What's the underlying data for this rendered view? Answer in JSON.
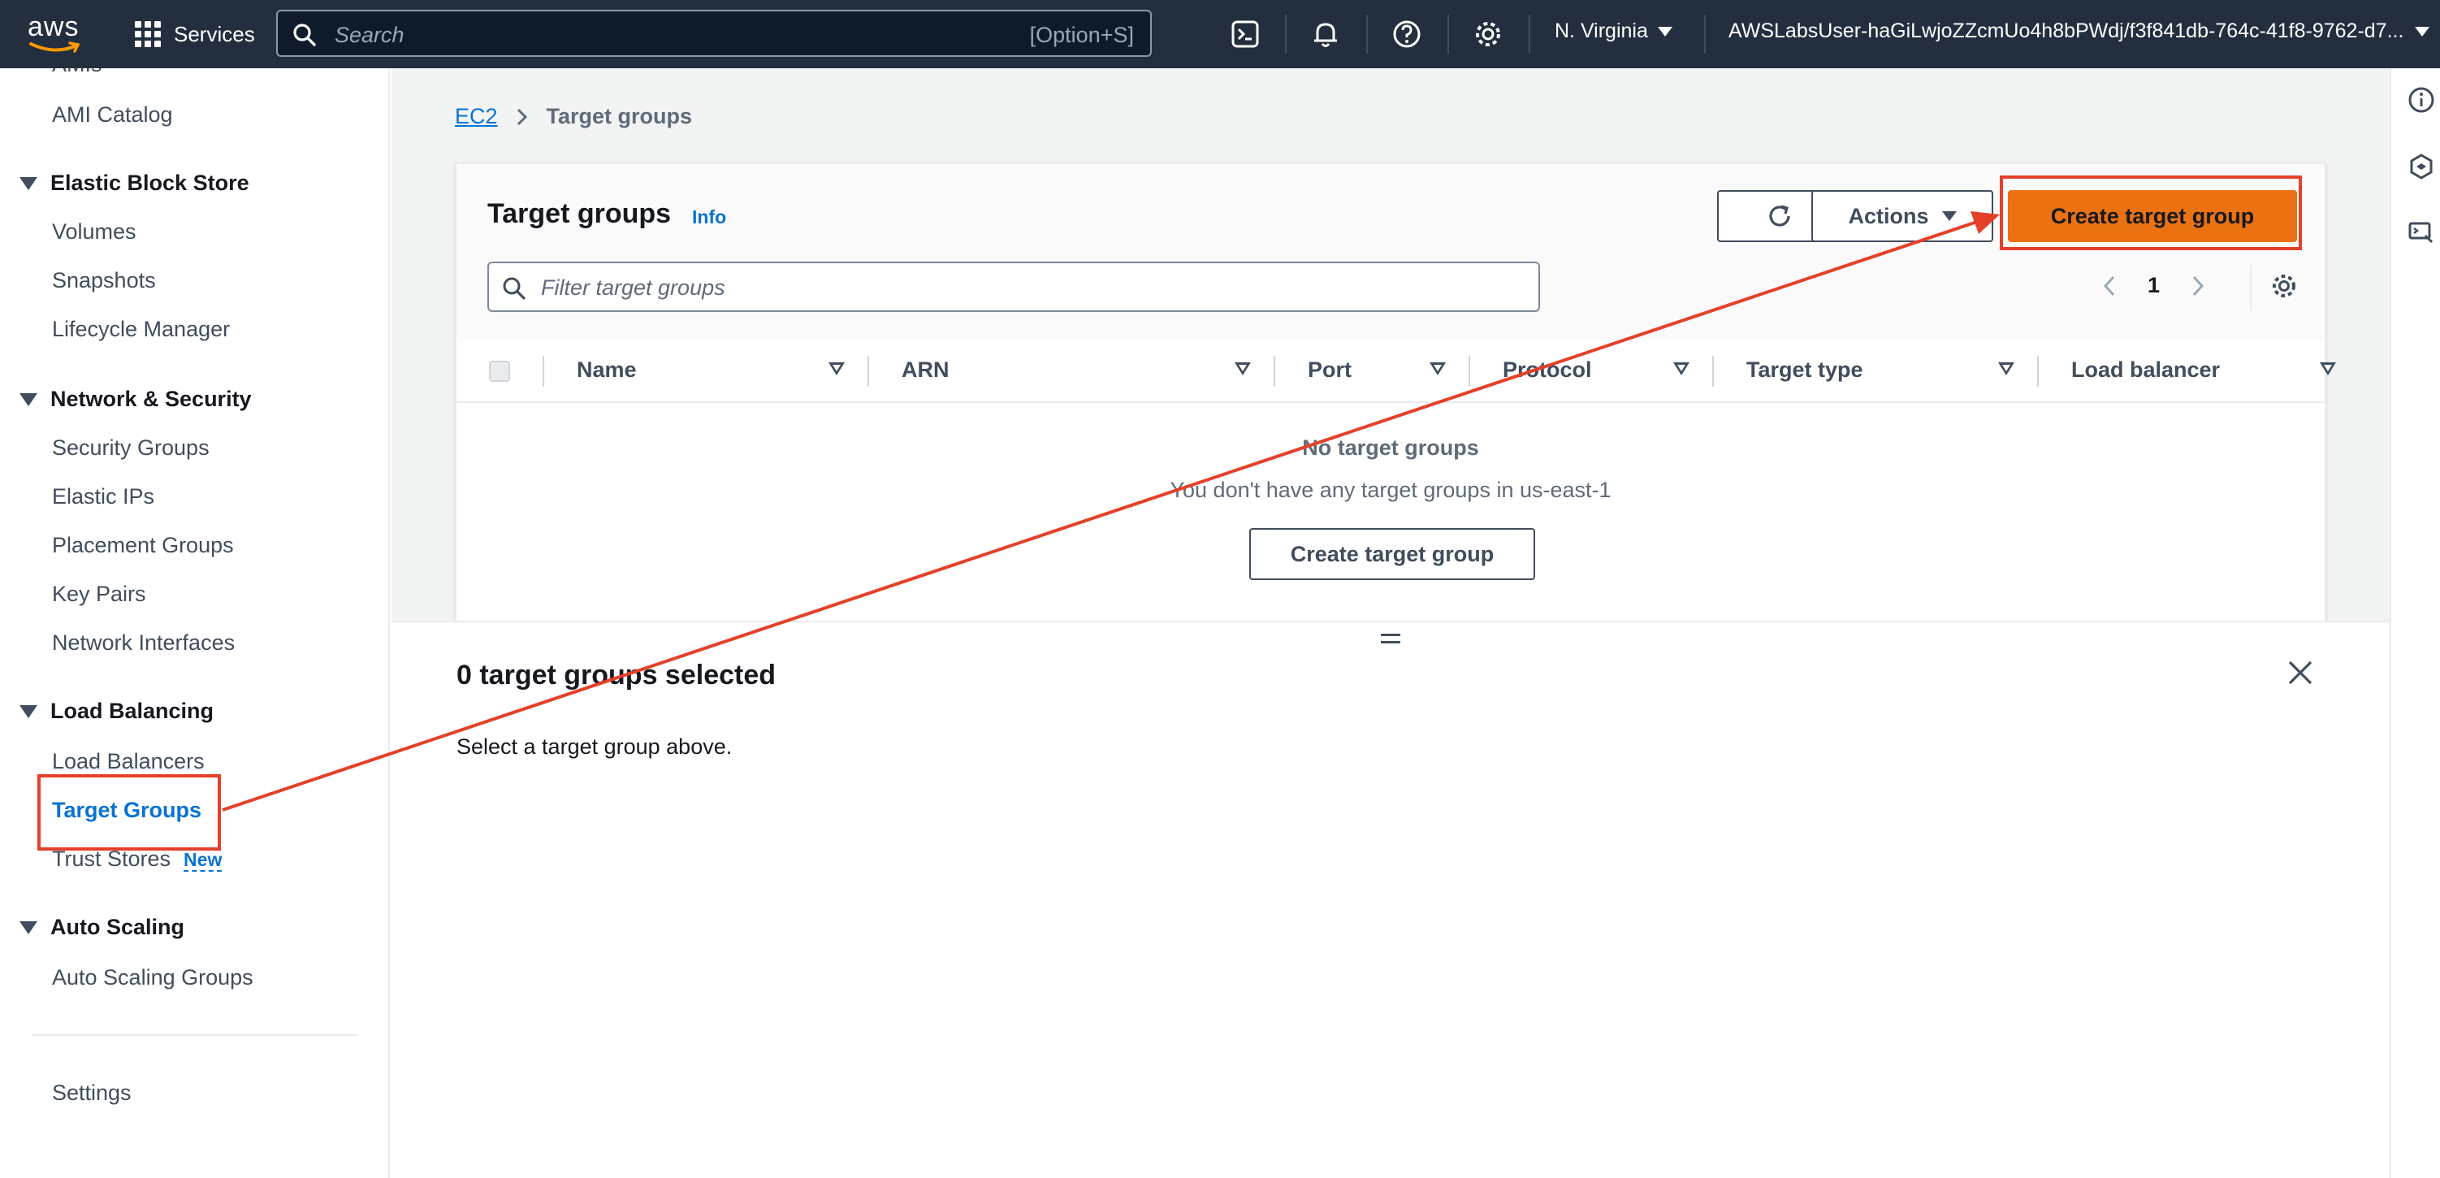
{
  "topnav": {
    "logo_text": "aws",
    "services_label": "Services",
    "search_placeholder": "Search",
    "search_shortcut": "[Option+S]",
    "region": "N. Virginia",
    "account": "AWSLabsUser-haGiLwjoZZcmUo4h8bPWdj/f3f841db-764c-41f8-9762-d7..."
  },
  "sidebar": {
    "partial_top_item": "AMIs",
    "ami_catalog": "AMI Catalog",
    "sections": [
      {
        "label": "Elastic Block Store",
        "items": [
          "Volumes",
          "Snapshots",
          "Lifecycle Manager"
        ]
      },
      {
        "label": "Network & Security",
        "items": [
          "Security Groups",
          "Elastic IPs",
          "Placement Groups",
          "Key Pairs",
          "Network Interfaces"
        ]
      },
      {
        "label": "Load Balancing",
        "items": [
          "Load Balancers",
          "Target Groups",
          "Trust Stores"
        ]
      },
      {
        "label": "Auto Scaling",
        "items": [
          "Auto Scaling Groups"
        ]
      }
    ],
    "new_badge": "New",
    "settings": "Settings",
    "active_item": "Target Groups"
  },
  "breadcrumb": {
    "root": "EC2",
    "current": "Target groups"
  },
  "table": {
    "title": "Target groups",
    "info": "Info",
    "actions_label": "Actions",
    "create_label": "Create target group",
    "filter_placeholder": "Filter target groups",
    "page": "1",
    "columns": [
      "Name",
      "ARN",
      "Port",
      "Protocol",
      "Target type",
      "Load balancer"
    ],
    "empty_title": "No target groups",
    "empty_description": "You don't have any target groups in us-east-1",
    "empty_create_label": "Create target group"
  },
  "split_panel": {
    "title": "0 target groups selected",
    "description": "Select a target group above."
  },
  "colors": {
    "nav_bg": "#232f3e",
    "primary_button": "#ec7211",
    "link": "#0972d3",
    "annotation": "#e5402a"
  }
}
